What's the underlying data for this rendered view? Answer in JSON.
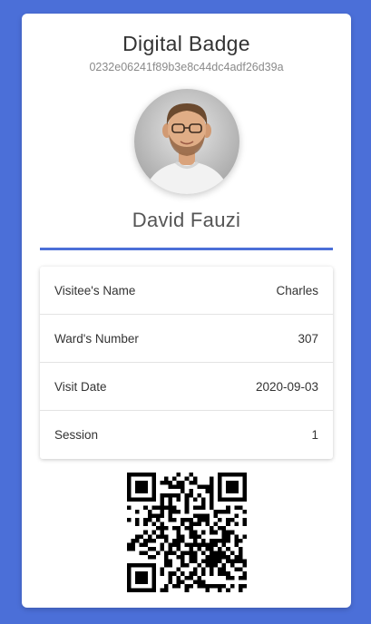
{
  "badge": {
    "title": "Digital Badge",
    "id": "0232e06241f89b3e8c44dc4adf26d39a",
    "visitor_name": "David Fauzi"
  },
  "details": [
    {
      "label": "Visitee's Name",
      "value": "Charles"
    },
    {
      "label": "Ward's Number",
      "value": "307"
    },
    {
      "label": "Visit Date",
      "value": "2020-09-03"
    },
    {
      "label": "Session",
      "value": "1"
    }
  ],
  "colors": {
    "background": "#4b6fd8",
    "accent": "#4b6fd8",
    "card": "#ffffff"
  }
}
